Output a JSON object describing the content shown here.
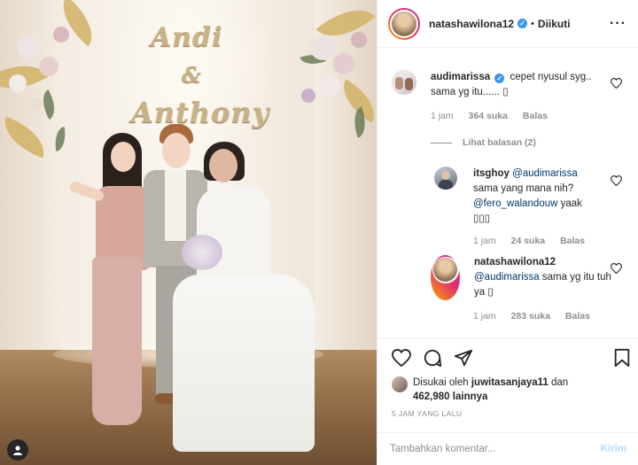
{
  "header": {
    "username": "natashawilona12",
    "follow_status": "Diikuti"
  },
  "comments": [
    {
      "username": "audimarissa",
      "text": "cepet nyusul syg.. sama yg itu......",
      "time": "1 jam",
      "likes": "364 suka",
      "reply": "Balas"
    },
    {
      "username": "itsghoy",
      "mention": "@audimarissa",
      "text": "sama yang mana nih?",
      "mention2": "@fero_walandouw",
      "text2": "yaak",
      "time": "1 jam",
      "likes": "24 suka",
      "reply": "Balas"
    },
    {
      "username": "natashawilona12",
      "mention": "@audimarissa",
      "text": "sama yg itu tuh ya",
      "time": "1 jam",
      "likes": "283 suka",
      "reply": "Balas"
    }
  ],
  "view_replies": "Lihat balasan (2)",
  "likes": {
    "prefix": "Disukai oleh",
    "user": "juwitasanjaya11",
    "joiner": "dan",
    "count": "462,980",
    "suffix": "lainnya"
  },
  "timestamp": "5 JAM YANG LALU",
  "comment_input": {
    "placeholder": "Tambahkan komentar...",
    "post_label": "Kirim"
  },
  "sign": {
    "line1": "Andi",
    "line2": "&",
    "line3": "Anthony"
  },
  "colors": {
    "verified": "#3897f0",
    "link": "#00376b",
    "muted": "#8e8e8e",
    "post_disabled": "#b3dbff"
  }
}
